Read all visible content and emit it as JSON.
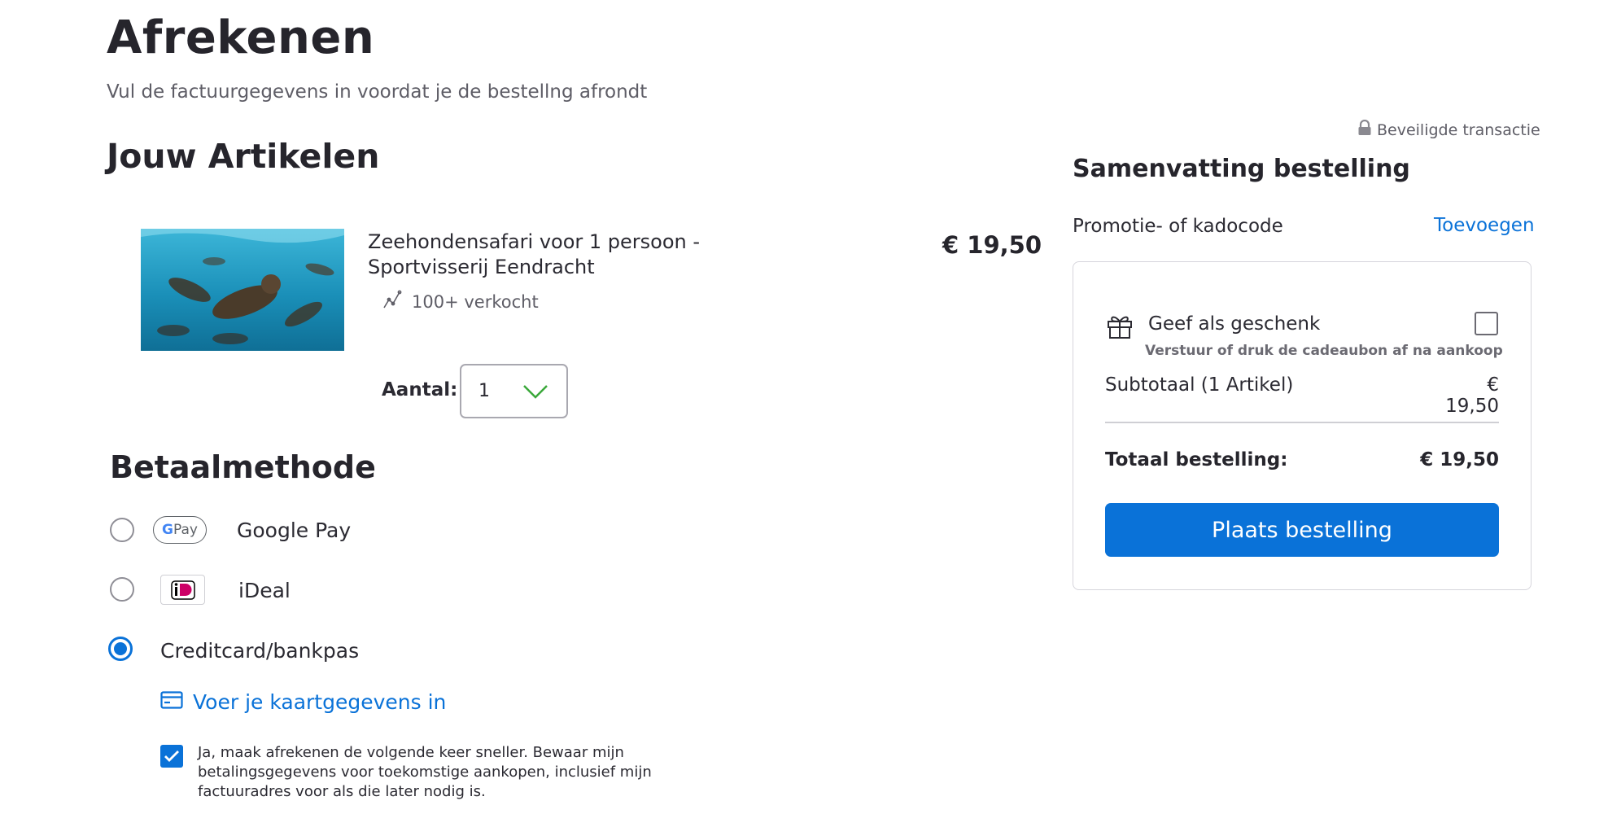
{
  "header": {
    "title": "Afrekenen",
    "subtitle": "Vul de factuurgegevens in voordat je de bestellng afrondt"
  },
  "items": {
    "heading": "Jouw Artikelen",
    "product": {
      "name": "Zeehondensafari voor 1 persoon - Sportvisserij Eendracht",
      "sold": "100+ verkocht",
      "price": "€ 19,50",
      "quantity_label": "Aantal:",
      "quantity_value": "1"
    }
  },
  "payment": {
    "heading": "Betaalmethode",
    "methods": [
      {
        "label": "Google Pay",
        "badge": "Pay",
        "selected": false
      },
      {
        "label": "iDeal",
        "badge": "iD",
        "selected": false
      },
      {
        "label": "Creditcard/bankpas",
        "selected": true
      }
    ],
    "card_link": "Voer je kaartgegevens in",
    "save_details": "Ja, maak afrekenen de volgende keer sneller. Bewaar mijn betalingsgegevens voor toekomstige aankopen, inclusief mijn factuuradres voor als die later nodig is."
  },
  "summary": {
    "secure": "Beveiligde transactie",
    "heading": "Samenvatting bestelling",
    "promo_label": "Promotie- of kadocode",
    "promo_add": "Toevoegen",
    "gift_label": "Geef als geschenk",
    "gift_sub": "Verstuur of druk de cadeaubon af na aankoop",
    "subtotal_label": "Subtotaal (1 Artikel)",
    "subtotal_value": "€ 19,50",
    "total_label": "Totaal bestelling:",
    "total_value": "€ 19,50",
    "place_order": "Plaats bestelling"
  },
  "colors": {
    "accent": "#0a72d8",
    "text": "#2b2a32",
    "muted": "#5e5d66"
  }
}
